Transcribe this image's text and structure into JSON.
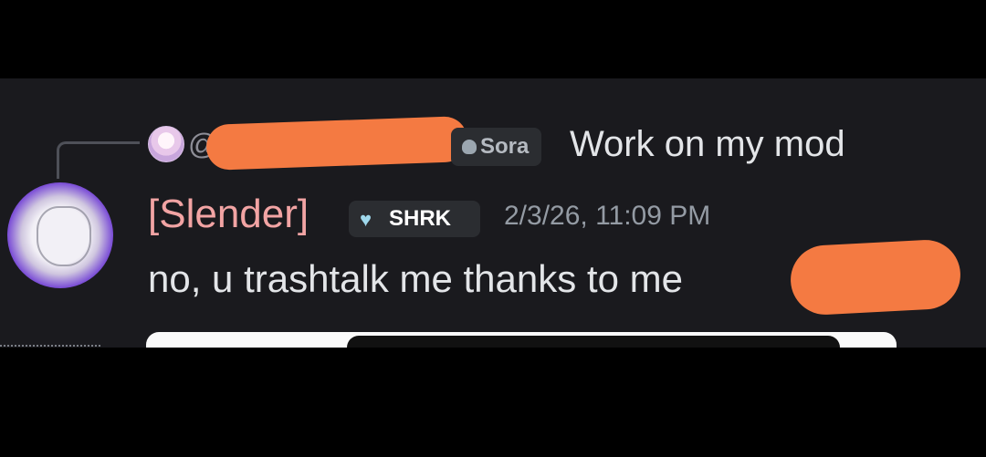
{
  "reply": {
    "at": "@",
    "role": "Sora",
    "text": "Work on my mod"
  },
  "message": {
    "username": "[Slender]",
    "tag": "SHRK",
    "timestamp": "2/3/26, 11:09 PM",
    "text": "no, u trashtalk me thanks to me"
  },
  "icons": {
    "reply_role_icon": "sora-icon",
    "tag_icon": "heart-icon"
  },
  "colors": {
    "background": "#1a1a1e",
    "username": "#f2a4a4",
    "redaction": "#f47a42",
    "text": "#e3e5e8",
    "muted": "#949ba4"
  }
}
